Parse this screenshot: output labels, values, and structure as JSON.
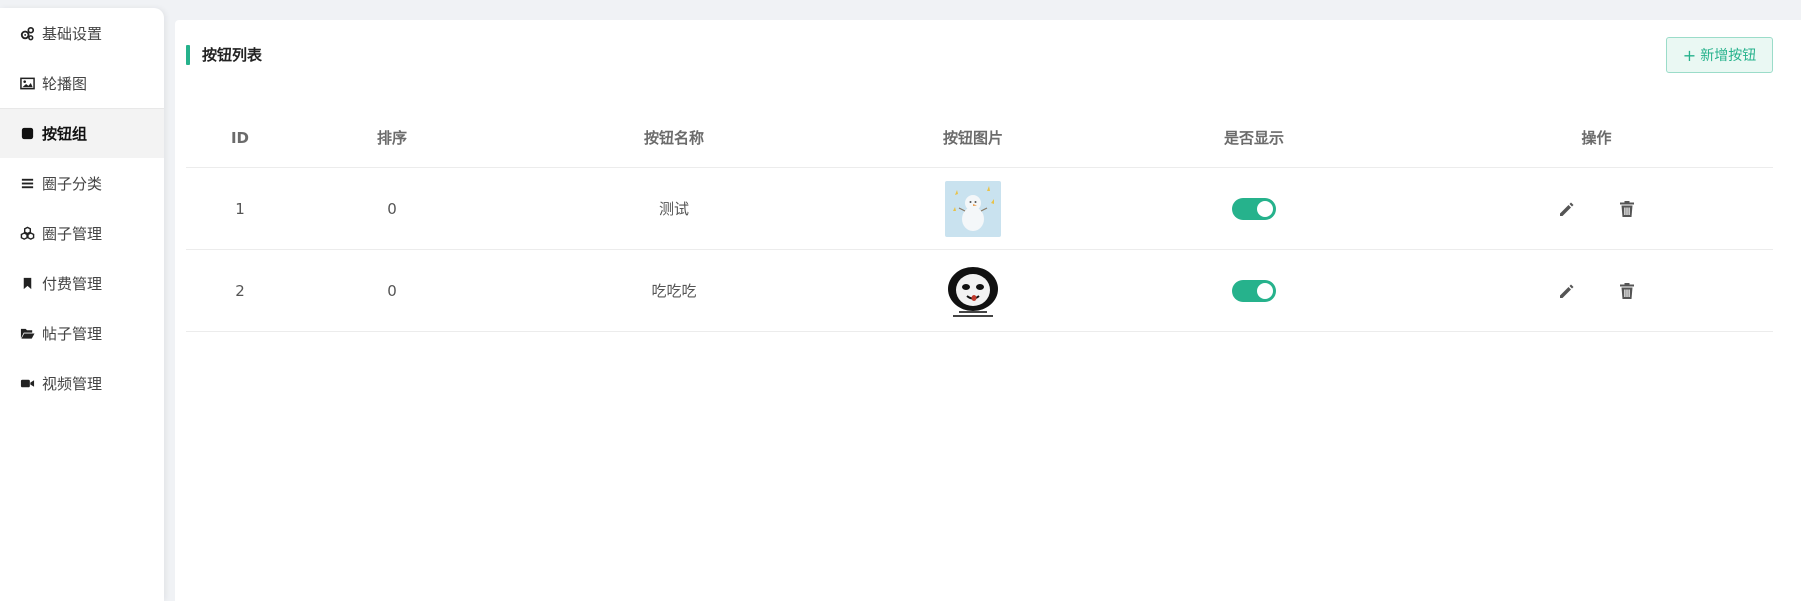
{
  "sidebar": {
    "items": [
      {
        "label": "基础设置",
        "icon": "gears-icon"
      },
      {
        "label": "轮播图",
        "icon": "image-icon"
      },
      {
        "label": "按钮组",
        "icon": "square-icon",
        "active": true
      },
      {
        "label": "圈子分类",
        "icon": "list-icon"
      },
      {
        "label": "圈子管理",
        "icon": "cubes-icon"
      },
      {
        "label": "付费管理",
        "icon": "bookmark-icon"
      },
      {
        "label": "帖子管理",
        "icon": "folder-open-icon"
      },
      {
        "label": "视频管理",
        "icon": "video-icon"
      }
    ]
  },
  "main": {
    "title": "按钮列表",
    "add_button": "新增按钮",
    "columns": [
      "ID",
      "排序",
      "按钮名称",
      "按钮图片",
      "是否显示",
      "操作"
    ],
    "rows": [
      {
        "id": "1",
        "sort": "0",
        "name": "测试",
        "image": "snowman-thumbnail",
        "visible": true
      },
      {
        "id": "2",
        "sort": "0",
        "name": "吃吃吃",
        "image": "panda-meme-thumbnail",
        "visible": true
      }
    ]
  },
  "colors": {
    "accent": "#26b28c",
    "background": "#f0f2f5"
  }
}
